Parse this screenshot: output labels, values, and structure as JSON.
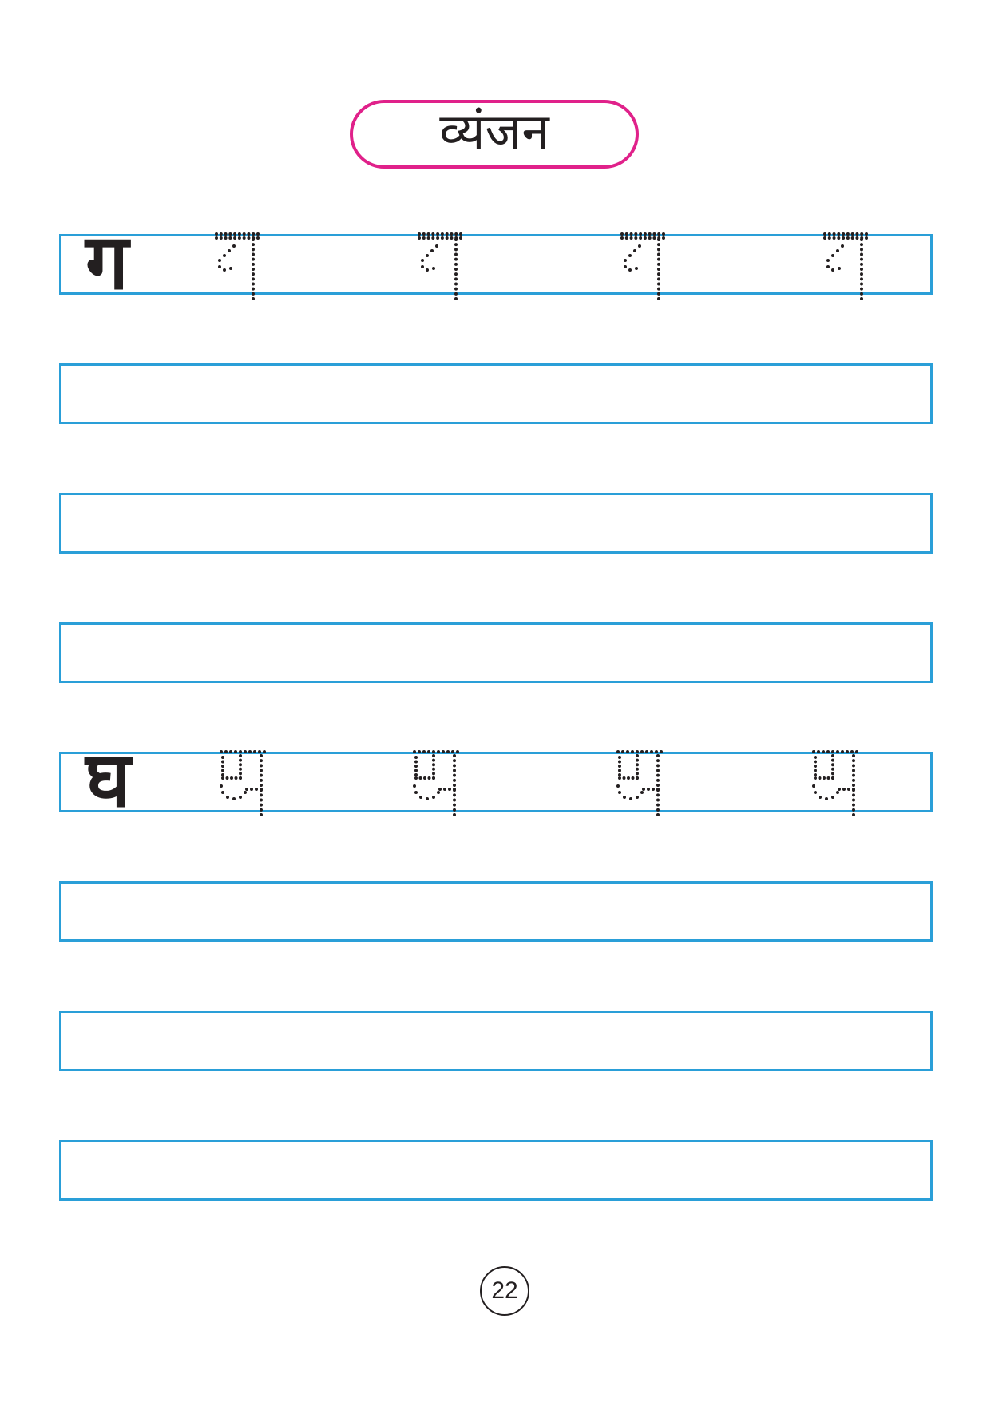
{
  "title": "व्यंजन",
  "sections": [
    {
      "letter": "ग",
      "trace_count": 4,
      "empty_rows": 3
    },
    {
      "letter": "घ",
      "trace_count": 4,
      "empty_rows": 3
    }
  ],
  "page_number": "22",
  "colors": {
    "title_border": "#e0218a",
    "row_border": "#2a9fd8",
    "ink": "#231f20",
    "trace_dots": "#231f20"
  }
}
